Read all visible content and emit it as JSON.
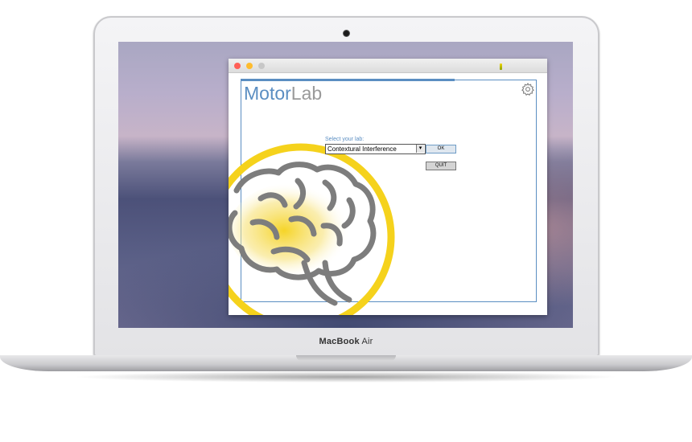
{
  "device": {
    "brand_name": "MacBook",
    "model_name": "Air"
  },
  "app": {
    "logo_primary": "Motor",
    "logo_secondary": "Lab",
    "select_label": "Select your lab:",
    "selected_lab": "Contextural Interference",
    "dropdown_glyph": "▾",
    "ok_label": "OK",
    "quit_label": "QUIT"
  },
  "colors": {
    "accent_blue": "#5b8ec2",
    "brain_yellow": "#f5d21c",
    "brain_outline": "#7d7d7d"
  },
  "icons": [
    "gear-icon",
    "brain-illustration"
  ]
}
